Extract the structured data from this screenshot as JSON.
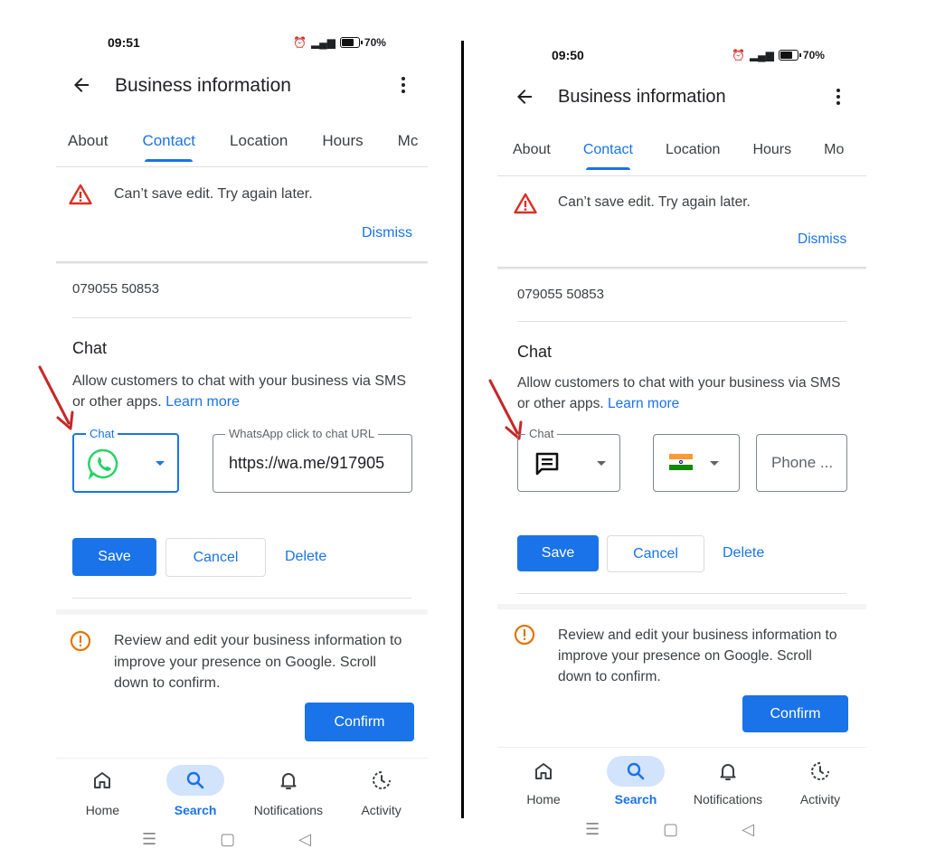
{
  "left": {
    "time": "09:51",
    "battery": "70%",
    "title": "Business information",
    "tabs": [
      "About",
      "Contact",
      "Location",
      "Hours",
      "Mc"
    ],
    "error_text": "Can’t save edit. Try again later.",
    "dismiss": "Dismiss",
    "phone": "079055 50853",
    "chat_heading": "Chat",
    "chat_desc": "Allow customers to chat with your business via SMS or other apps.",
    "learn_more": "Learn more",
    "chat_field_label": "Chat",
    "url_field_label": "WhatsApp click to chat URL",
    "url_value": "https://wa.me/917905",
    "save": "Save",
    "cancel": "Cancel",
    "delete": "Delete",
    "review_text": "Review and edit your business information to improve your presence on Google. Scroll down to confirm.",
    "confirm": "Confirm",
    "nav": [
      "Home",
      "Search",
      "Notifications",
      "Activity"
    ]
  },
  "right": {
    "time": "09:50",
    "battery": "70%",
    "title": "Business information",
    "tabs": [
      "About",
      "Contact",
      "Location",
      "Hours",
      "Mo"
    ],
    "error_text": "Can’t save edit. Try again later.",
    "dismiss": "Dismiss",
    "phone": "079055 50853",
    "chat_heading": "Chat",
    "chat_desc": "Allow customers to chat with your business via SMS or other apps.",
    "learn_more": "Learn more",
    "chat_field_label": "Chat",
    "phone_placeholder": "Phone ...",
    "save": "Save",
    "cancel": "Cancel",
    "delete": "Delete",
    "review_text": "Review and edit your business information to improve your presence on Google. Scroll down to confirm.",
    "confirm": "Confirm",
    "nav": [
      "Home",
      "Search",
      "Notifications",
      "Activity"
    ]
  },
  "colors": {
    "accent": "#1a73e8",
    "error": "#d93025",
    "warning": "#e37400",
    "annotation_arrow": "#c62828",
    "whatsapp": "#25d366"
  },
  "icons": [
    "back-arrow-icon",
    "more-vert-icon",
    "warning-triangle-icon",
    "whatsapp-icon",
    "sms-chat-icon",
    "india-flag-icon",
    "info-circle-icon",
    "home-icon",
    "search-icon",
    "bell-icon",
    "activity-icon",
    "alarm-icon",
    "signal-icon",
    "battery-icon"
  ]
}
